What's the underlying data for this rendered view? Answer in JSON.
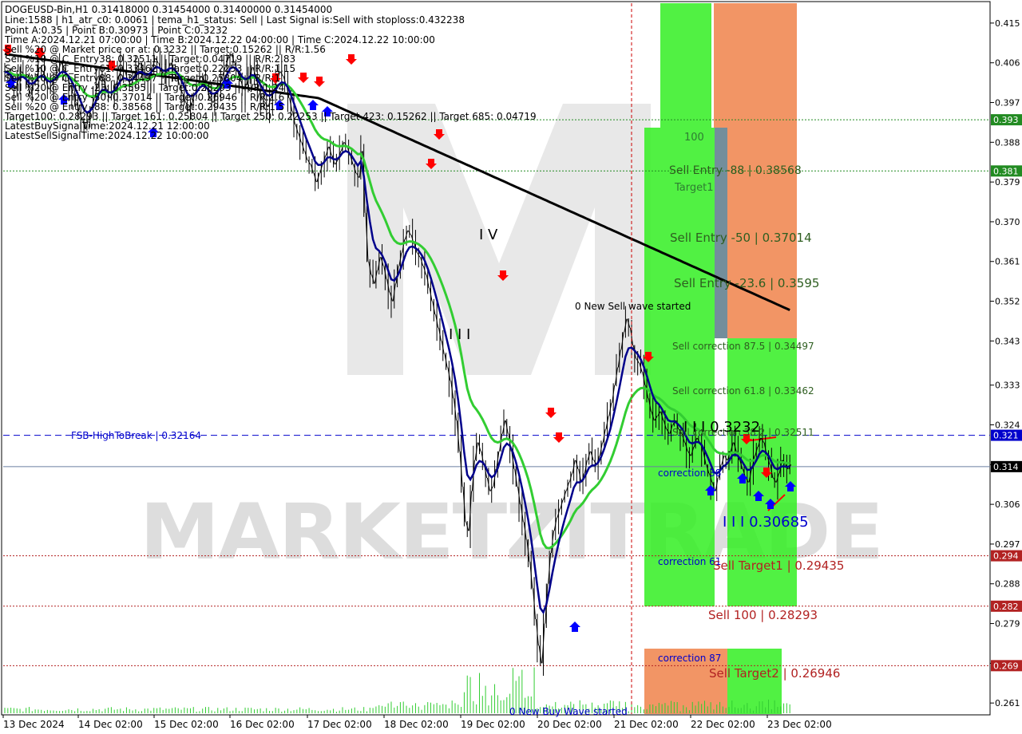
{
  "header": {
    "symbol_line": "DOGEUSD-Bin,H1  0.31418000 0.31454000 0.31400000 0.31454000",
    "lines": [
      "Line:1588 | h1_atr_c0: 0.0061 | tema_h1_status: Sell | Last Signal is:Sell with stoploss:0.432238",
      "Point A:0.35 | Point B:0.30973 | Point C:0.3232",
      "Time A:2024.12.21 07:00:00 | Time B:2024.12.22 04:00:00 | Time C:2024.12.22 10:00:00",
      "Sell %20 @ Market price or at: 0.3232 || Target:0.15262 || R/R:1.56",
      "Sell %10 @ C_Entry38: 0.32511 || Target:0.04719 || R/R:2.83",
      "Sell %10 @ C_Entry61: 0.33462 || Target:0.22253 || R/R:1.15",
      "Sell %10 @ C_Entry88: 0.34497 || Target:0.25804 || R/R:1",
      "Sell %20 @ Entry -23: 0.3595 || Target:0.28293 || R/R:1.24",
      "Sell %20 @ Entry -50: 0.37014 || Target:0.26946 || R/R:1.6",
      "Sell %20 @ Entry -88: 0.38568 || Target:0.29435 || R/R:1.5",
      "Target100: 0.28293 || Target 161: 0.25804 || Target 250: 0.22253 || Target 423: 0.15262 || Target 685: 0.04719",
      "LatestBuySignalTime:2024.12.21 12:00:00",
      "LatestSellSignalTime:2024.12.22 10:00:00"
    ]
  },
  "watermark": "MARKETZITRADE",
  "colors": {
    "ema_fast": "#00008b",
    "ema_mid": "#32cd32",
    "ema_slow": "#000000",
    "zone_green": "#33ee22",
    "zone_orange": "#f0824a",
    "zone_gray": "#5a7a8a",
    "sell_arrow": "#ff0000",
    "buy_arrow": "#0000ff",
    "level_red": "#b22222",
    "level_green": "#228b22",
    "level_blue": "#0000cc",
    "candle": "#000000",
    "volume": "#32cd32"
  },
  "annotations": {
    "sell_entry_88": "Sell Entry -88 | 0.38568",
    "target1_label": "Target1",
    "label_100": "100",
    "sell_entry_50": "Sell Entry -50 | 0.37014",
    "sell_entry_23": "Sell Entry -23.6 | 0.3595",
    "new_sell_wave": "0 New Sell wave started",
    "sell_corr_875": "Sell correction 87.5 | 0.34497",
    "sell_corr_618": "Sell correction 61.8 | 0.33462",
    "sell_corr_382": "Sell correction 38.2 | 0.32511",
    "point_c": "I I I 0.3232",
    "fsb": "FSB-HighToBreak | 0.32164",
    "correction_38": "correction 38",
    "point_b": "I I I 0.30685",
    "correction_61": "correction 61",
    "sell_target1": "Sell Target1 | 0.29435",
    "sell_100": "Sell 100 | 0.28293",
    "correction_87": "correction 87",
    "sell_target2": "Sell Target2 | 0.26946",
    "new_buy_wave": "0 New Buy Wave started",
    "wave_iv": "I V",
    "wave_iii": "I I I"
  },
  "chart_data": {
    "type": "candlestick",
    "ylim": [
      0.2585,
      0.4195
    ],
    "y_ticks": [
      "0.415",
      "0.406",
      "0.397",
      "0.388",
      "0.379",
      "0.370",
      "0.361",
      "0.352",
      "0.343",
      "0.333",
      "0.324",
      "0.315",
      "0.306",
      "0.297",
      "0.288",
      "0.279",
      "0.270",
      "0.261"
    ],
    "x_ticks": [
      "13 Dec 2024",
      "14 Dec 02:00",
      "15 Dec 02:00",
      "16 Dec 02:00",
      "17 Dec 02:00",
      "18 Dec 02:00",
      "19 Dec 02:00",
      "20 Dec 02:00",
      "21 Dec 02:00",
      "22 Dec 02:00",
      "23 Dec 02:00"
    ],
    "price_tags": [
      {
        "text": "0.393",
        "value": 0.3931,
        "color": "#228b22"
      },
      {
        "text": "0.381",
        "value": 0.3815,
        "color": "#228b22"
      },
      {
        "text": "0.321",
        "value": 0.32164,
        "color": "#0000cc"
      },
      {
        "text": "0.314",
        "value": 0.31454,
        "color": "#000000"
      },
      {
        "text": "0.294",
        "value": 0.29435,
        "color": "#b22222"
      },
      {
        "text": "0.282",
        "value": 0.28293,
        "color": "#b22222"
      },
      {
        "text": "0.269",
        "value": 0.26946,
        "color": "#b22222"
      }
    ],
    "levels": [
      {
        "value": 0.3931,
        "color": "#228b22",
        "style": "dot"
      },
      {
        "value": 0.3815,
        "color": "#228b22",
        "style": "dot"
      },
      {
        "value": 0.32164,
        "color": "#0000cc",
        "style": "dash"
      },
      {
        "value": 0.31454,
        "color": "#6a7fa0",
        "style": "solid"
      },
      {
        "value": 0.29435,
        "color": "#b22222",
        "style": "dot"
      },
      {
        "value": 0.28293,
        "color": "#b22222",
        "style": "dot"
      },
      {
        "value": 0.26946,
        "color": "#b22222",
        "style": "dot"
      }
    ],
    "closes": [
      0.404,
      0.403,
      0.402,
      0.4,
      0.402,
      0.404,
      0.403,
      0.401,
      0.399,
      0.401,
      0.403,
      0.405,
      0.404,
      0.402,
      0.4,
      0.401,
      0.403,
      0.404,
      0.406,
      0.405,
      0.403,
      0.401,
      0.399,
      0.397,
      0.395,
      0.393,
      0.391,
      0.393,
      0.396,
      0.398,
      0.401,
      0.403,
      0.402,
      0.4,
      0.398,
      0.399,
      0.401,
      0.403,
      0.405,
      0.404,
      0.402,
      0.401,
      0.403,
      0.405,
      0.406,
      0.404,
      0.402,
      0.403,
      0.405,
      0.407,
      0.406,
      0.404,
      0.403,
      0.404,
      0.406,
      0.405,
      0.403,
      0.401,
      0.399,
      0.397,
      0.395,
      0.397,
      0.399,
      0.401,
      0.403,
      0.402,
      0.4,
      0.398,
      0.397,
      0.399,
      0.401,
      0.403,
      0.405,
      0.407,
      0.408,
      0.406,
      0.404,
      0.402,
      0.4,
      0.401,
      0.403,
      0.405,
      0.403,
      0.4,
      0.398,
      0.397,
      0.396,
      0.398,
      0.4,
      0.402,
      0.404,
      0.403,
      0.401,
      0.398,
      0.395,
      0.392,
      0.39,
      0.388,
      0.386,
      0.384,
      0.383,
      0.381,
      0.379,
      0.381,
      0.383,
      0.385,
      0.387,
      0.385,
      0.383,
      0.384,
      0.386,
      0.388,
      0.387,
      0.385,
      0.383,
      0.381,
      0.38,
      0.386,
      0.372,
      0.361,
      0.358,
      0.356,
      0.359,
      0.362,
      0.36,
      0.357,
      0.354,
      0.352,
      0.356,
      0.36,
      0.363,
      0.366,
      0.368,
      0.367,
      0.365,
      0.363,
      0.362,
      0.36,
      0.358,
      0.355,
      0.352,
      0.349,
      0.346,
      0.343,
      0.34,
      0.337,
      0.334,
      0.33,
      0.325,
      0.318,
      0.31,
      0.302,
      0.3,
      0.309,
      0.316,
      0.32,
      0.318,
      0.315,
      0.312,
      0.309,
      0.31,
      0.314,
      0.318,
      0.322,
      0.325,
      0.322,
      0.318,
      0.314,
      0.31,
      0.306,
      0.302,
      0.298,
      0.293,
      0.287,
      0.28,
      0.274,
      0.27,
      0.279,
      0.288,
      0.295,
      0.3,
      0.303,
      0.305,
      0.307,
      0.309,
      0.311,
      0.313,
      0.316,
      0.314,
      0.311,
      0.313,
      0.316,
      0.318,
      0.316,
      0.315,
      0.317,
      0.32,
      0.323,
      0.326,
      0.329,
      0.333,
      0.337,
      0.341,
      0.345,
      0.348,
      0.346,
      0.342,
      0.339,
      0.338,
      0.336,
      0.333,
      0.33,
      0.327,
      0.325,
      0.326,
      0.327,
      0.325,
      0.323,
      0.322,
      0.324,
      0.325,
      0.323,
      0.322,
      0.32,
      0.318,
      0.317,
      0.319,
      0.321,
      0.32,
      0.318,
      0.315,
      0.313,
      0.311,
      0.309,
      0.312,
      0.315,
      0.317,
      0.316,
      0.318,
      0.32,
      0.318,
      0.316,
      0.314,
      0.312,
      0.311,
      0.314,
      0.317,
      0.319,
      0.321,
      0.32,
      0.317,
      0.315,
      0.312,
      0.311,
      0.313,
      0.316,
      0.315,
      0.314,
      0.315
    ]
  }
}
